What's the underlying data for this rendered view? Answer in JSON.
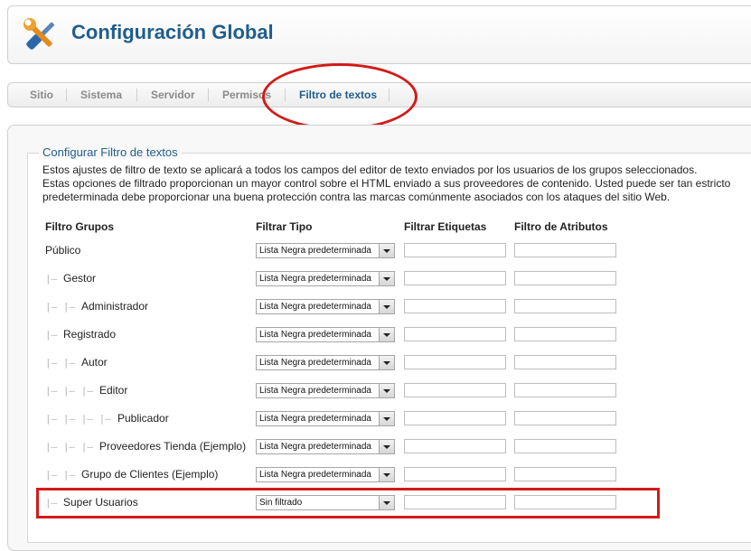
{
  "header": {
    "title": "Configuración Global",
    "icon": "tools-icon"
  },
  "tabs": [
    {
      "label": "Sitio",
      "active": false
    },
    {
      "label": "Sistema",
      "active": false
    },
    {
      "label": "Servidor",
      "active": false
    },
    {
      "label": "Permisos",
      "active": false
    },
    {
      "label": "Filtro de textos",
      "active": true
    }
  ],
  "filter": {
    "legend": "Configurar Filtro de textos",
    "description": [
      "Estos ajustes de filtro de texto se aplicará a todos los campos del editor de texto enviados por los usuarios de los grupos seleccionados.",
      "Estas opciones de filtrado proporcionan un mayor control sobre el HTML enviado a sus proveedores de contenido. Usted puede ser tan estricto",
      "predeterminada debe proporcionar una buena protección contra las marcas comúnmente asociados con los ataques del sitio Web."
    ],
    "columns": {
      "groups": "Filtro Grupos",
      "type": "Filtrar Tipo",
      "tags": "Filtrar Etiquetas",
      "attributes": "Filtro de Atributos"
    },
    "rows": [
      {
        "tree": "",
        "label": "Público",
        "type": "Lista Negra predeterminada",
        "tags": "",
        "attributes": ""
      },
      {
        "tree": "|—",
        "label": "Gestor",
        "type": "Lista Negra predeterminada",
        "tags": "",
        "attributes": ""
      },
      {
        "tree": "|— |—",
        "label": "Administrador",
        "type": "Lista Negra predeterminada",
        "tags": "",
        "attributes": ""
      },
      {
        "tree": "|—",
        "label": "Registrado",
        "type": "Lista Negra predeterminada",
        "tags": "",
        "attributes": ""
      },
      {
        "tree": "|— |—",
        "label": "Autor",
        "type": "Lista Negra predeterminada",
        "tags": "",
        "attributes": ""
      },
      {
        "tree": "|— |— |—",
        "label": "Editor",
        "type": "Lista Negra predeterminada",
        "tags": "",
        "attributes": ""
      },
      {
        "tree": "|— |— |— |—",
        "label": "Publicador",
        "type": "Lista Negra predeterminada",
        "tags": "",
        "attributes": ""
      },
      {
        "tree": "|— |— |—",
        "label": "Proveedores Tienda (Ejemplo)",
        "type": "Lista Negra predeterminada",
        "tags": "",
        "attributes": ""
      },
      {
        "tree": "|— |—",
        "label": "Grupo de Clientes (Ejemplo)",
        "type": "Lista Negra predeterminada",
        "tags": "",
        "attributes": ""
      },
      {
        "tree": "|—",
        "label": "Super Usuarios",
        "type": "Sin filtrado",
        "tags": "",
        "attributes": ""
      }
    ]
  },
  "annotation_color": "#d31a1a"
}
